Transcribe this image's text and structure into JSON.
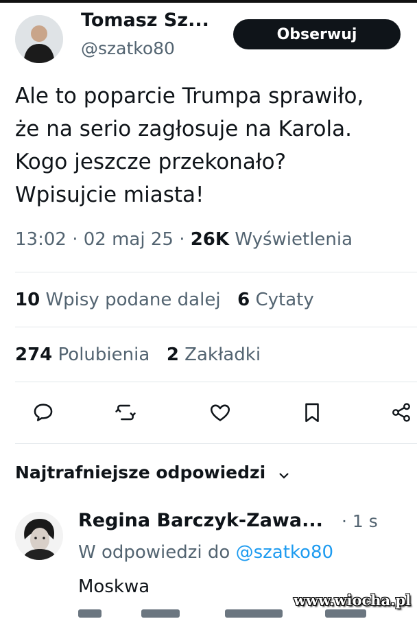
{
  "author": {
    "name": "Tomasz Sz...",
    "handle": "@szatko80",
    "follow_label": "Obserwuj"
  },
  "tweet": {
    "lines": [
      "Ale to poparcie Trumpa sprawiło,",
      "że na serio zagłosuje na Karola.",
      "Kogo jeszcze przekonało?",
      "Wpisujcie miasta!"
    ],
    "time": "13:02",
    "date": "02 maj 25",
    "views_count": "26K",
    "views_label": "Wyświetlenia"
  },
  "stats": {
    "reposts_count": "10",
    "reposts_label": "Wpisy podane dalej",
    "quotes_count": "6",
    "quotes_label": "Cytaty",
    "likes_count": "274",
    "likes_label": "Polubienia",
    "bookmarks_count": "2",
    "bookmarks_label": "Zakładki"
  },
  "actions": [
    "reply-icon",
    "repost-icon",
    "like-icon",
    "bookmark-icon",
    "share-icon"
  ],
  "replies_section": {
    "label": "Najtrafniejsze odpowiedzi"
  },
  "reply": {
    "name": "Regina Barczyk-Zawa...",
    "time": "· 1 s",
    "reply_to_prefix": "W odpowiedzi do",
    "reply_to_handle": "@szatko80",
    "text": "Moskwa"
  },
  "watermark": "www.wiocha.pl",
  "colors": {
    "text": "#0f1419",
    "secondary": "#536471",
    "link": "#1d9bf0",
    "button_bg": "#0f1419"
  }
}
